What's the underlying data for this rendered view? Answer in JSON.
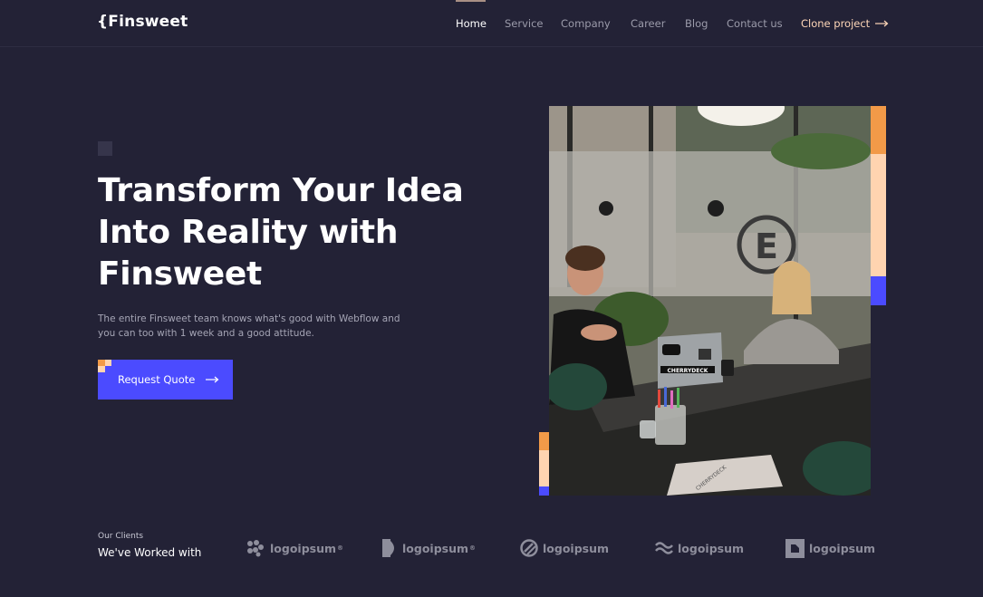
{
  "header": {
    "logo": "{Finsweet",
    "nav": [
      "Home",
      "Service",
      "Company",
      "Career",
      "Blog",
      "Contact us"
    ],
    "active": "Home",
    "clone_link": "Clone project"
  },
  "hero": {
    "title_lines": [
      "Transform Your Idea",
      "Into Reality with",
      "Finsweet"
    ],
    "subtitle_lines": [
      "The entire Finsweet team knows what's good with Webflow and",
      "you can too with 1 week and a good attitude."
    ],
    "cta_label": "Request Quote"
  },
  "photo": {
    "laptop_sticker": "CHERRYDECK",
    "laptop_sticker_2": "CHERRYDECK",
    "icon": "team-meeting-photo"
  },
  "clients": {
    "label": "Our Clients",
    "title": "We've Worked with",
    "logos": [
      {
        "name": "logoipsum",
        "mark": "®",
        "icon": "dots-cluster-icon"
      },
      {
        "name": "logoipsum",
        "mark": "®",
        "icon": "half-square-icon"
      },
      {
        "name": "logoipsum",
        "mark": "",
        "icon": "striped-circle-icon"
      },
      {
        "name": "logoipsum",
        "mark": "",
        "icon": "waves-icon"
      },
      {
        "name": "logoipsum",
        "mark": "",
        "icon": "square-notch-icon"
      }
    ]
  },
  "colors": {
    "background": "#232236",
    "accent_blue": "#4b4bff",
    "accent_orange": "#f29a48",
    "accent_peach": "#ffd4b0",
    "clone_link": "#ffd7b8"
  }
}
